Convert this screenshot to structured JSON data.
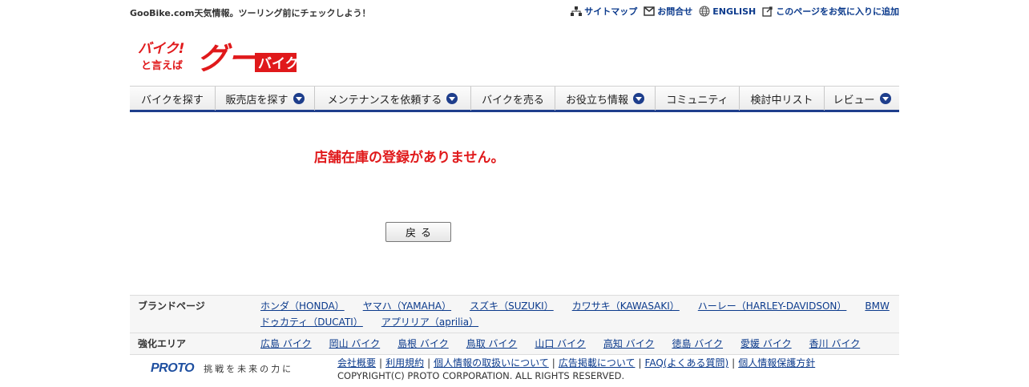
{
  "header": {
    "tagline": "GooBike.com天気情報。ツーリング前にチェックしよう！",
    "utility_links": [
      {
        "label": "サイトマップ",
        "icon": "sitemap-icon"
      },
      {
        "label": "お問合せ",
        "icon": "mail-icon"
      },
      {
        "label": "ENGLISH",
        "icon": "globe-icon"
      },
      {
        "label": "このページをお気に入りに追加",
        "icon": "bookmark-icon"
      }
    ],
    "logo": {
      "line1": "バイク!",
      "line2": "と言えば",
      "goo": "グー",
      "bike": "バイク"
    }
  },
  "nav": {
    "items": [
      {
        "label": "バイクを探す",
        "dropdown": false
      },
      {
        "label": "販売店を探す",
        "dropdown": true
      },
      {
        "label": "メンテナンスを依頼する",
        "dropdown": true
      },
      {
        "label": "バイクを売る",
        "dropdown": false
      },
      {
        "label": "お役立ち情報",
        "dropdown": true
      },
      {
        "label": "コミュニティ",
        "dropdown": false
      },
      {
        "label": "検討中リスト",
        "dropdown": false
      },
      {
        "label": "レビュー",
        "dropdown": true
      }
    ]
  },
  "main": {
    "message": "店舗在庫の登録がありません。",
    "back_button": "戻る"
  },
  "footer": {
    "brand_label": "ブランドページ",
    "brands": [
      "ホンダ（HONDA）",
      "ヤマハ（YAMAHA）",
      "スズキ（SUZUKI）",
      "カワサキ（KAWASAKI）",
      "ハーレー（HARLEY-DAVIDSON）",
      "BMW",
      "ドゥカティ（DUCATI）",
      "アプリリア（aprilia）"
    ],
    "area_label": "強化エリア",
    "areas": [
      "広島 バイク",
      "岡山 バイク",
      "島根 バイク",
      "鳥取 バイク",
      "山口 バイク",
      "高知 バイク",
      "徳島 バイク",
      "愛媛 バイク",
      "香川 バイク"
    ],
    "proto_logo": "PROTO",
    "proto_tagline": "挑戦を未来の力に",
    "bottom_links": [
      "会社概要",
      "利用規約",
      "個人情報の取扱いについて",
      "広告掲載について",
      "FAQ(よくある質問)",
      "個人情報保護方針"
    ],
    "copyright": "COPYRIGHT(C) PROTO CORPORATION. ALL RIGHTS RESERVED."
  },
  "colors": {
    "brand_red": "#e0191b",
    "nav_blue": "#1e3e8c",
    "link_blue": "#0b3a8c"
  }
}
